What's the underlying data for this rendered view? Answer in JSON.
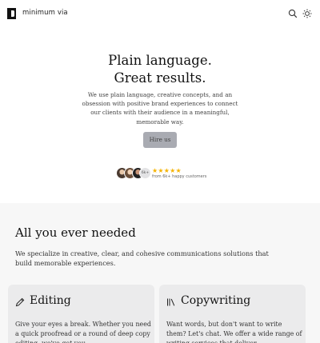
{
  "header": {
    "brand": "minimum via",
    "icons": [
      "logo-icon",
      "search-icon",
      "sun-icon"
    ]
  },
  "hero": {
    "title_line1": "Plain language.",
    "title_line2": "Great results.",
    "description": "We use plain language, creative concepts, and an obsession with positive brand experiences to connect our clients with their audience in a meaningful, memorable way.",
    "cta_label": "Hire us",
    "avatar_more": "6k+",
    "stars": "★★★★★",
    "rating_text": "from 6k+ happy customers"
  },
  "features": {
    "title": "All you ever needed",
    "description": "We specialize in creative, clear, and cohesive communications solutions that build memorable experiences.",
    "cards": [
      {
        "icon": "pencil-icon",
        "title": "Editing",
        "body": "Give your eyes a break. Whether you need a quick proofread or a round of deep copy editing, we've got you."
      },
      {
        "icon": "books-icon",
        "title": "Copywriting",
        "body": "Want words, but don't want to write them? Let's chat. We offer a wide range of writing services that deliver."
      }
    ]
  },
  "colors": {
    "cta_background": "#a9abb2",
    "star": "#f5b301",
    "section_background": "#f7f7f7",
    "card_background": "#ebebec"
  }
}
